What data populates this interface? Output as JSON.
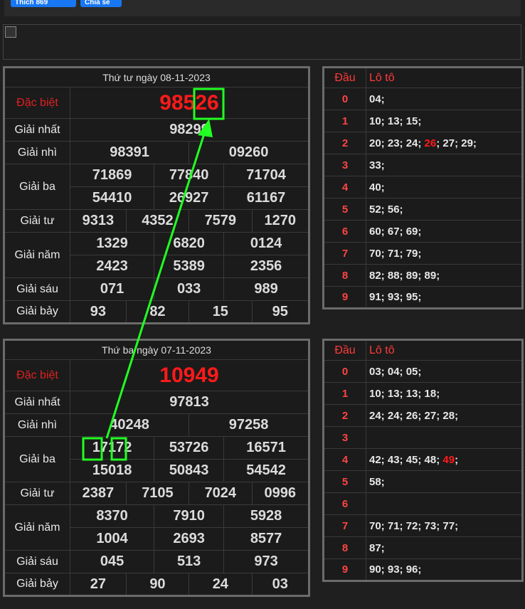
{
  "topbar": {
    "like_label": "Thích 869",
    "share_label": "Chia sẻ"
  },
  "day1": {
    "header": "Thứ tư ngày 08-11-2023",
    "labels": {
      "db": "Đặc biệt",
      "g1": "Giải nhất",
      "g2": "Giải nhì",
      "g3": "Giải ba",
      "g4": "Giải tư",
      "g5": "Giải năm",
      "g6": "Giải sáu",
      "g7": "Giải bảy"
    },
    "db": "98526",
    "g1": "98299",
    "g2": [
      "98391",
      "09260"
    ],
    "g3": [
      "71869",
      "77840",
      "71704",
      "54410",
      "26927",
      "61167"
    ],
    "g4": [
      "9313",
      "4352",
      "7579",
      "1270"
    ],
    "g5": [
      "1329",
      "6820",
      "0124",
      "2423",
      "5389",
      "2356"
    ],
    "g6": [
      "071",
      "033",
      "989"
    ],
    "g7": [
      "93",
      "82",
      "15",
      "95"
    ],
    "loto": {
      "head_dau": "Đầu",
      "head_loto": "Lô tô",
      "rows": [
        {
          "d": "0",
          "v": "04;"
        },
        {
          "d": "1",
          "v": "10; 13; 15;"
        },
        {
          "d": "2",
          "pre": "20; 23; 24; ",
          "hl": "26",
          "post": "; 27; 29;"
        },
        {
          "d": "3",
          "v": "33;"
        },
        {
          "d": "4",
          "v": "40;"
        },
        {
          "d": "5",
          "v": "52; 56;"
        },
        {
          "d": "6",
          "v": "60; 67; 69;"
        },
        {
          "d": "7",
          "v": "70; 71; 79;"
        },
        {
          "d": "8",
          "v": "82; 88; 89; 89;"
        },
        {
          "d": "9",
          "v": "91; 93; 95;"
        }
      ]
    }
  },
  "day2": {
    "header": "Thứ ba ngày 07-11-2023",
    "labels": {
      "db": "Đặc biệt",
      "g1": "Giải nhất",
      "g2": "Giải nhì",
      "g3": "Giải ba",
      "g4": "Giải tư",
      "g5": "Giải năm",
      "g6": "Giải sáu",
      "g7": "Giải bảy"
    },
    "db": "10949",
    "g1": "97813",
    "g2": [
      "40248",
      "97258"
    ],
    "g3": [
      "17172",
      "53726",
      "16571",
      "15018",
      "50843",
      "54542"
    ],
    "g4": [
      "2387",
      "7105",
      "7024",
      "0996"
    ],
    "g5": [
      "8370",
      "7910",
      "5928",
      "1004",
      "2693",
      "8577"
    ],
    "g6": [
      "045",
      "513",
      "973"
    ],
    "g7": [
      "27",
      "90",
      "24",
      "03"
    ],
    "loto": {
      "head_dau": "Đầu",
      "head_loto": "Lô tô",
      "rows": [
        {
          "d": "0",
          "v": "03; 04; 05;"
        },
        {
          "d": "1",
          "v": "10; 13; 13; 18;"
        },
        {
          "d": "2",
          "v": "24; 24; 26; 27; 28;"
        },
        {
          "d": "3",
          "v": ""
        },
        {
          "d": "4",
          "pre": "42; 43; 45; 48; ",
          "hl": "49",
          "post": ";"
        },
        {
          "d": "5",
          "v": "58;"
        },
        {
          "d": "6",
          "v": ""
        },
        {
          "d": "7",
          "v": "70; 71; 72; 73; 77;"
        },
        {
          "d": "8",
          "v": "87;"
        },
        {
          "d": "9",
          "v": "90; 93; 96;"
        }
      ]
    }
  },
  "colors": {
    "highlight": "#ff1a1a",
    "annotation": "#22ff22",
    "loto_head": "#ff4444"
  }
}
